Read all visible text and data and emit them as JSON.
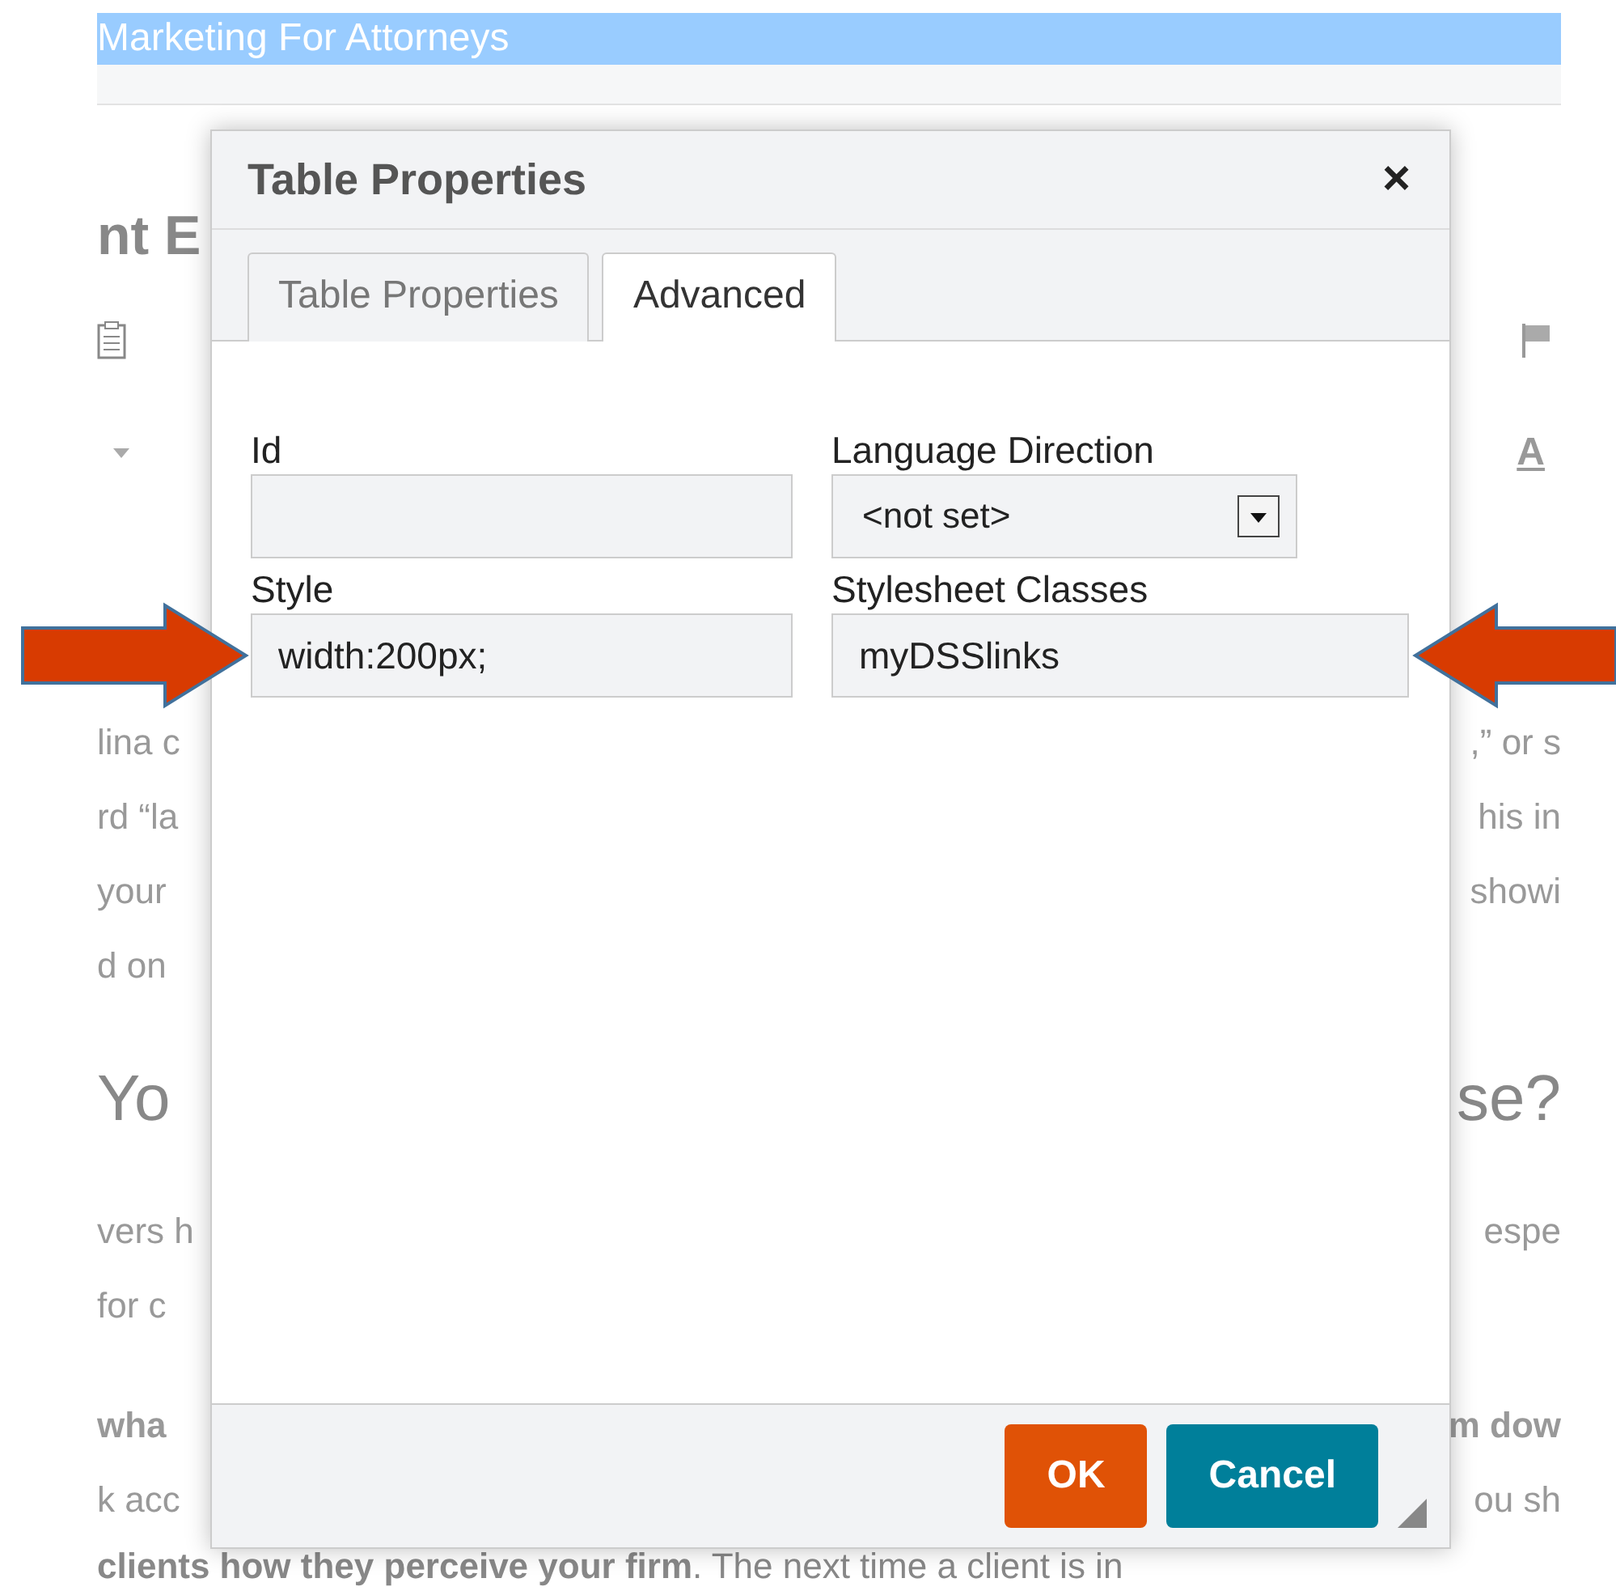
{
  "page": {
    "banner": "Marketing For Attorneys",
    "heading": "nt E",
    "font_color_button": "A",
    "lines": [
      {
        "left": "lina c",
        "right": ",” or s",
        "bold": false
      },
      {
        "left": "rd “la",
        "right": "his in",
        "bold": false
      },
      {
        "left": "your",
        "right": "showi",
        "bold": false
      },
      {
        "left": "d on",
        "bold": false
      }
    ],
    "heading_2": {
      "left": "Yo",
      "right": "se?"
    },
    "lines_2": [
      {
        "left": "vers h",
        "right": "espe",
        "bold": false
      },
      {
        "left": "for c",
        "bold": false
      },
      {
        "left": "wha",
        "right": "m dow",
        "bold": true
      },
      {
        "left": "k acc",
        "right": "ou sh",
        "bold": false
      }
    ],
    "last_line": "**clients how they perceive your firm**. The next time a client is in"
  },
  "dialog": {
    "title": "Table Properties",
    "close": "×",
    "tabs": [
      {
        "label": "Table Properties",
        "selected": false
      },
      {
        "label": "Advanced",
        "selected": true
      }
    ],
    "fields": [
      {
        "label": "Id",
        "kind": "text"
      },
      {
        "label": "Language Direction",
        "kind": "select",
        "value": "<not set>"
      },
      {
        "label": "Style",
        "kind": "text",
        "value": "width:200px;"
      },
      {
        "label": "Stylesheet Classes",
        "kind": "text",
        "value": "myDSSlinks"
      }
    ],
    "buttons": [
      {
        "label": "OK",
        "kind": "primary"
      },
      {
        "label": "Cancel",
        "kind": "secondary"
      }
    ]
  }
}
